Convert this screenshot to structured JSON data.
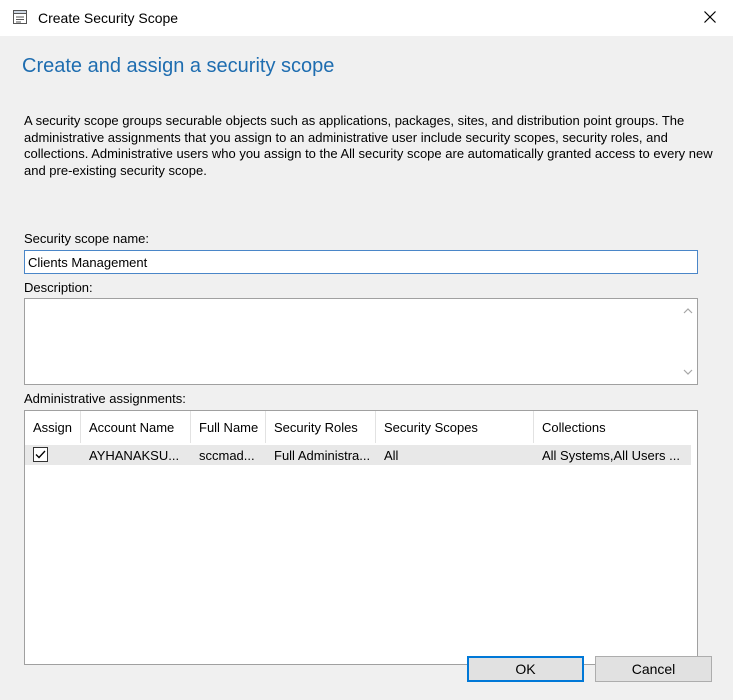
{
  "window": {
    "title": "Create Security Scope",
    "icon": "dialog-app-icon",
    "close_icon": "close-icon"
  },
  "page": {
    "heading": "Create and assign a security scope",
    "intro": "A security scope groups securable objects such as applications, packages, sites, and distribution point groups. The administrative assignments that you assign to an administrative user include security scopes, security roles, and collections.  Administrative users who you assign to the All security scope are automatically granted access to every new and pre-existing security scope."
  },
  "form": {
    "name_label": "Security scope name:",
    "name_value": "Clients Management",
    "description_label": "Description:",
    "description_value": "",
    "assignments_label": "Administrative assignments:"
  },
  "table": {
    "columns": [
      "Assign",
      "Account Name",
      "Full Name",
      "Security Roles",
      "Security Scopes",
      "Collections"
    ],
    "rows": [
      {
        "assign": true,
        "account_name": "AYHANAKSU...",
        "full_name": "sccmad...",
        "security_roles": "Full Administra...",
        "security_scopes": "All",
        "collections": "All Systems,All Users ..."
      }
    ]
  },
  "buttons": {
    "ok": "OK",
    "cancel": "Cancel"
  },
  "colors": {
    "accent": "#0078d7",
    "heading": "#1e6db0",
    "background": "#f0f0f0"
  }
}
